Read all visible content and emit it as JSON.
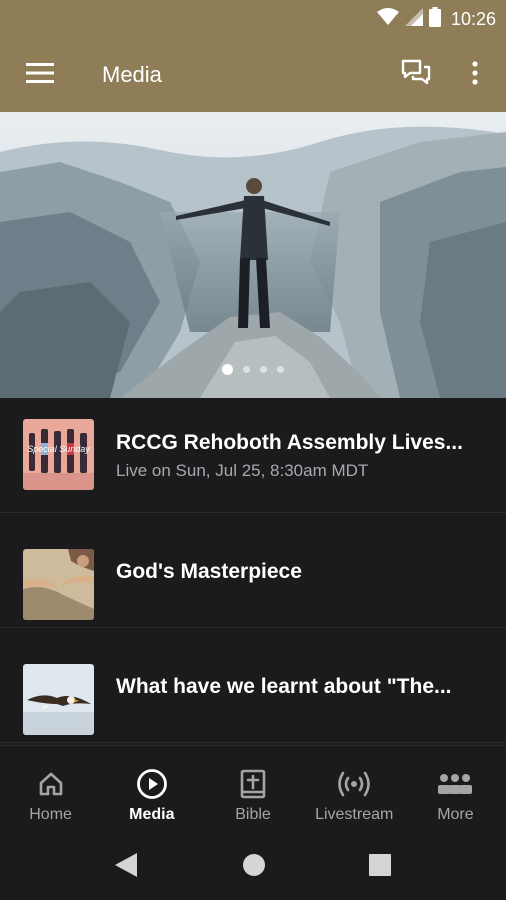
{
  "status_bar": {
    "time": "10:26",
    "icons": [
      "wifi-icon",
      "cellular-signal-icon",
      "battery-icon"
    ]
  },
  "app_bar": {
    "title": "Media",
    "icons": [
      "menu-icon",
      "chat-icon",
      "more-vert-icon"
    ],
    "color": "#8e7d56"
  },
  "hero": {
    "image": "man standing on mountain summit with arms outstretched",
    "slide_count": 4,
    "active_slide": 1
  },
  "media_list": [
    {
      "title": "RCCG Rehoboth Assembly Lives...",
      "subtitle": "Live on Sun, Jul 25, 8:30am MDT",
      "thumb_text": "Special Sunday"
    },
    {
      "title": "God's Masterpiece",
      "subtitle": ""
    },
    {
      "title": "What have we learnt about \"The...",
      "subtitle": ""
    }
  ],
  "bottom_nav": [
    {
      "label": "Home",
      "icon": "home-icon",
      "active": false
    },
    {
      "label": "Media",
      "icon": "play-circle-icon",
      "active": true
    },
    {
      "label": "Bible",
      "icon": "bible-icon",
      "active": false
    },
    {
      "label": "Livestream",
      "icon": "broadcast-icon",
      "active": false
    },
    {
      "label": "More",
      "icon": "people-icon",
      "active": false
    }
  ],
  "system_nav": [
    "back-icon",
    "home-circle-icon",
    "recents-icon"
  ],
  "colors": {
    "accent": "#8e7d56",
    "background": "#1b1b1d",
    "text_secondary": "#a9a9ad"
  }
}
